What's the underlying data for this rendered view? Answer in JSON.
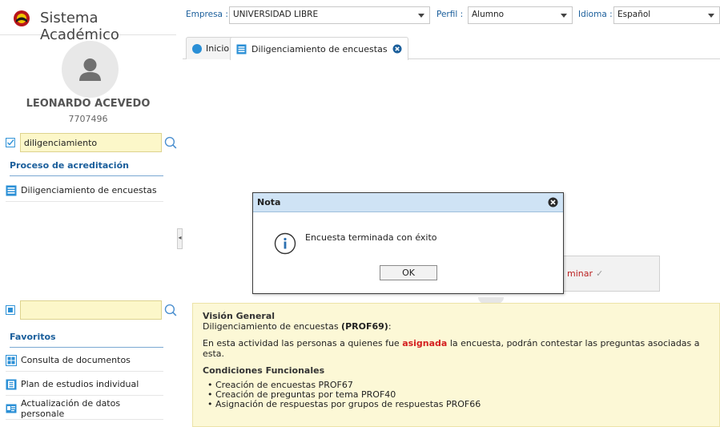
{
  "app": {
    "title": "Sistema Académico"
  },
  "user": {
    "name": "LEONARDO ACEVEDO",
    "id": "7707496"
  },
  "topbar": {
    "empresa_label": "Empresa :",
    "empresa_value": "UNIVERSIDAD LIBRE",
    "perfil_label": "Perfil :",
    "perfil_value": "Alumno",
    "idioma_label": "Idioma :",
    "idioma_value": "Español"
  },
  "sidebar": {
    "search_value": "diligenciamiento",
    "section1_title": "Proceso de acreditación",
    "section1_items": [
      {
        "label": "Diligenciamiento de encuestas"
      }
    ],
    "search2_value": "",
    "favorites_title": "Favoritos",
    "favorites_items": [
      {
        "label": "Consulta de documentos"
      },
      {
        "label": "Plan de estudios individual"
      },
      {
        "label": "Actualización de datos personale"
      }
    ]
  },
  "tabs": [
    {
      "label": "Inicio"
    },
    {
      "label": "Diligenciamiento de encuestas"
    }
  ],
  "finish_button": {
    "label_visible": "minar",
    "check": "✓"
  },
  "info": {
    "title": "Visión General",
    "subtitle_prefix": "Diligenciamiento de encuestas ",
    "subtitle_code": "(PROF69)",
    "subtitle_suffix": ":",
    "desc_prefix": "En esta actividad las personas a quienes fue ",
    "desc_highlight": "asignada",
    "desc_suffix": " la encuesta, podrán contestar las preguntas asociadas a esta.",
    "conditions_title": "Condiciones Funcionales",
    "conditions": [
      "Creación de encuestas PROF67",
      "Creación de preguntas por tema PROF40",
      "Asignación de respuestas por grupos de respuestas PROF66"
    ]
  },
  "modal": {
    "title": "Nota",
    "message": "Encuesta terminada con éxito",
    "ok_label": "OK"
  },
  "colors": {
    "accent_blue": "#1a5e9b",
    "search_bg": "#fcf7c9",
    "info_bg": "#fcf8d6",
    "modal_header_bg": "#cfe3f5",
    "highlight_red": "#d42020"
  },
  "icons": {
    "brand": "university-logo-icon",
    "search": "search-icon",
    "checkbox": "checkbox-icon",
    "list": "list-icon",
    "close": "close-circle-icon",
    "info": "info-icon"
  }
}
